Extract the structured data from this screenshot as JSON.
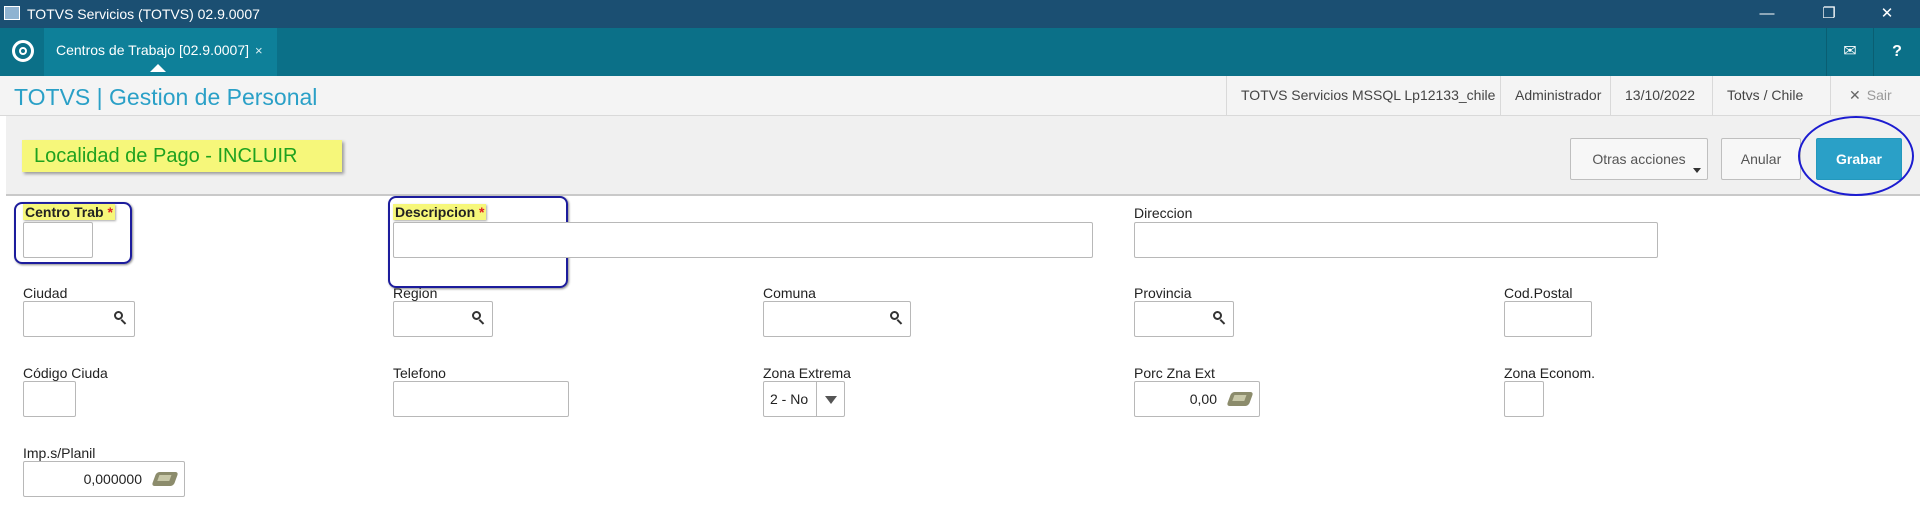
{
  "window": {
    "title": "TOTVS Servicios (TOTVS) 02.9.0007",
    "minimize": "—",
    "restore": "❐",
    "close": "✕"
  },
  "tabbar": {
    "tab_label": "Centros de Trabajo [02.9.0007]",
    "tab_close": "×",
    "mail_icon": "✉",
    "help_icon": "?"
  },
  "header": {
    "app_title": "TOTVS | Gestion de Personal",
    "environment": "TOTVS Servicios MSSQL Lp12133_chile",
    "user": "Administrador",
    "date": "13/10/2022",
    "company": "Totvs / Chile",
    "exit_label": "Sair",
    "exit_icon": "✕"
  },
  "toolbar": {
    "form_title": "Localidad de Pago - INCLUIR",
    "other_actions": "Otras acciones",
    "cancel": "Anular",
    "save": "Grabar"
  },
  "form": {
    "required_mark": "*",
    "centro_trab": {
      "label": "Centro Trab",
      "value": ""
    },
    "descripcion": {
      "label": "Descripcion",
      "value": ""
    },
    "direccion": {
      "label": "Direccion",
      "value": ""
    },
    "ciudad": {
      "label": "Ciudad",
      "value": ""
    },
    "region": {
      "label": "Region",
      "value": ""
    },
    "comuna": {
      "label": "Comuna",
      "value": ""
    },
    "provincia": {
      "label": "Provincia",
      "value": ""
    },
    "cod_postal": {
      "label": "Cod.Postal",
      "value": ""
    },
    "codigo_ciuda": {
      "label": "Código Ciuda",
      "value": ""
    },
    "telefono": {
      "label": "Telefono",
      "value": ""
    },
    "zona_extrema": {
      "label": "Zona Extrema",
      "value": "2 - No"
    },
    "porc_zna_ext": {
      "label": "Porc Zna Ext",
      "value": "0,00"
    },
    "zona_econom": {
      "label": "Zona Econom.",
      "value": ""
    },
    "imp_planil": {
      "label": "Imp.s/Planil",
      "value": "0,000000"
    }
  },
  "colors": {
    "titlebar": "#1b4f72",
    "tabbar": "#0b7088",
    "accent": "#2aa0c7",
    "highlight": "#f6f77a",
    "annotation": "#1c1cd0"
  }
}
